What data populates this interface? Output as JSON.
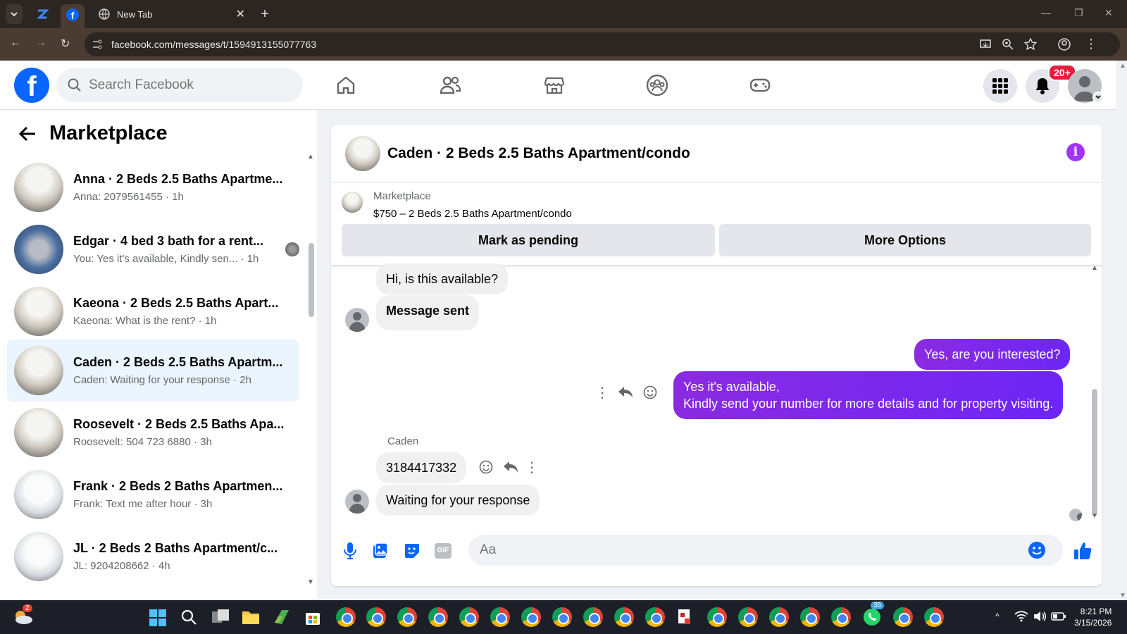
{
  "browser": {
    "tab_title": "New Tab",
    "url": "facebook.com/messages/t/1594913155077763"
  },
  "header": {
    "search_placeholder": "Search Facebook",
    "notifications_badge": "20+"
  },
  "sidebar": {
    "title": "Marketplace",
    "conversations": [
      {
        "name": "Anna · 2 Beds 2.5 Baths Apartme...",
        "preview": "Anna: 2079561455 · 1h"
      },
      {
        "name": "Edgar · 4 bed 3 bath for a rent...",
        "preview": "You: Yes it's available, Kindly sen...  · 1h"
      },
      {
        "name": "Kaeona · 2 Beds 2.5 Baths Apart...",
        "preview": "Kaeona: What is the rent? · 1h"
      },
      {
        "name": "Caden · 2 Beds 2.5 Baths Apartm...",
        "preview": "Caden: Waiting for your response · 2h"
      },
      {
        "name": "Roosevelt · 2 Beds 2.5 Baths Apa...",
        "preview": "Roosevelt: 504 723 6880 · 3h"
      },
      {
        "name": "Frank · 2 Beds 2 Baths Apartmen...",
        "preview": "Frank: Text me after hour · 3h"
      },
      {
        "name": "JL · 2 Beds 2 Baths Apartment/c...",
        "preview": "JL: 9204208662 · 4h"
      }
    ]
  },
  "chat": {
    "title": "Caden · 2 Beds 2.5 Baths Apartment/condo",
    "listing_category": "Marketplace",
    "listing_title": "$750 – 2 Beds 2.5 Baths Apartment/condo",
    "mark_pending_label": "Mark as pending",
    "more_options_label": "More Options",
    "messages": {
      "m1": "Hi, is this available?",
      "m2": "Message sent",
      "m3": "Yes, are you interested?",
      "m4_line1": "Yes it's available,",
      "m4_line2": "Kindly send your number for more details and for property visiting.",
      "sender": "Caden",
      "m5": "3184417332",
      "m6": "Waiting for your response"
    },
    "composer_placeholder": "Aa"
  },
  "taskbar": {
    "weather_badge": "2",
    "whatsapp_badge": "35",
    "time": "8:21 PM",
    "date": "3/15/2026"
  },
  "colors": {
    "fb_blue": "#0866ff",
    "messenger_purple": "#7a1cff",
    "badge_red": "#e41e3f"
  }
}
